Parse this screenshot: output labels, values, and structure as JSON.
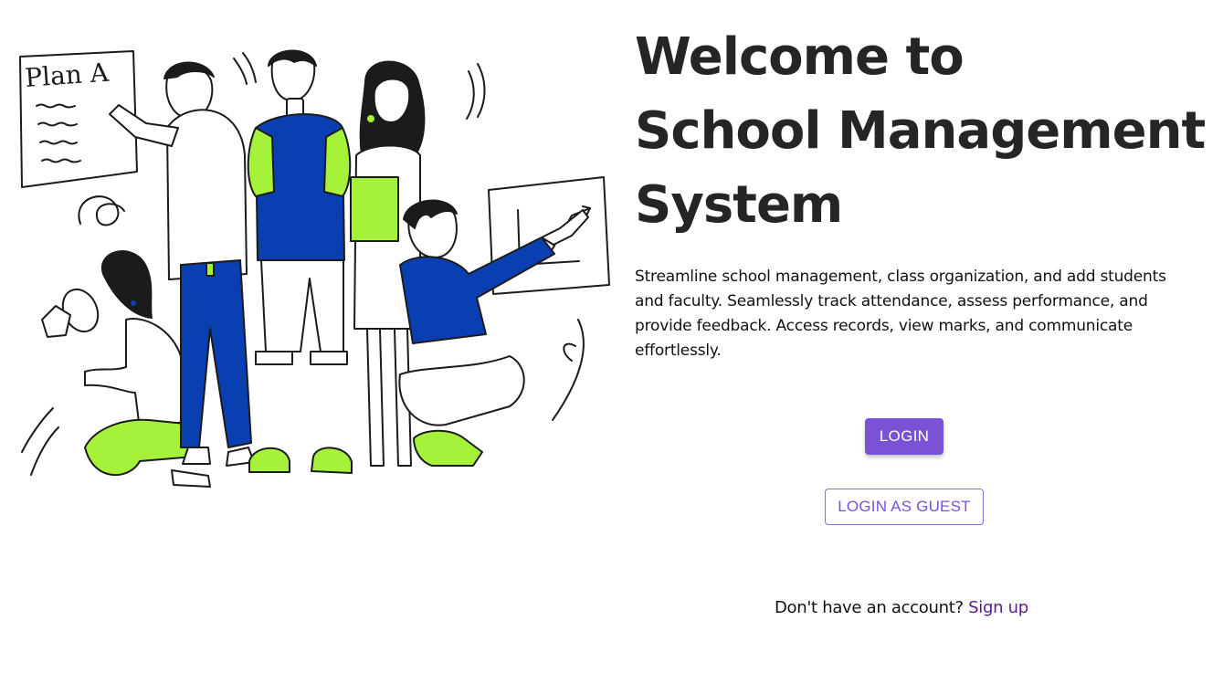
{
  "hero": {
    "title_lines": [
      "Welcome to",
      "School Management",
      "System"
    ],
    "description": "Streamline school management, class organization, and add students and faculty. Seamlessly track attendance, assess performance, and provide feedback. Access records, view marks, and communicate effortlessly."
  },
  "illustration": {
    "whiteboard_text": "Plan A"
  },
  "actions": {
    "login_label": "LOGIN",
    "guest_label": "LOGIN AS GUEST"
  },
  "signup": {
    "prompt": "Don't have an account?",
    "link_label": "Sign up"
  },
  "colors": {
    "accent": "#7a52d6",
    "link": "#5a1b8c",
    "heading": "#252525",
    "illustration_blue": "#0a3fb2",
    "illustration_green": "#a6f23a"
  }
}
